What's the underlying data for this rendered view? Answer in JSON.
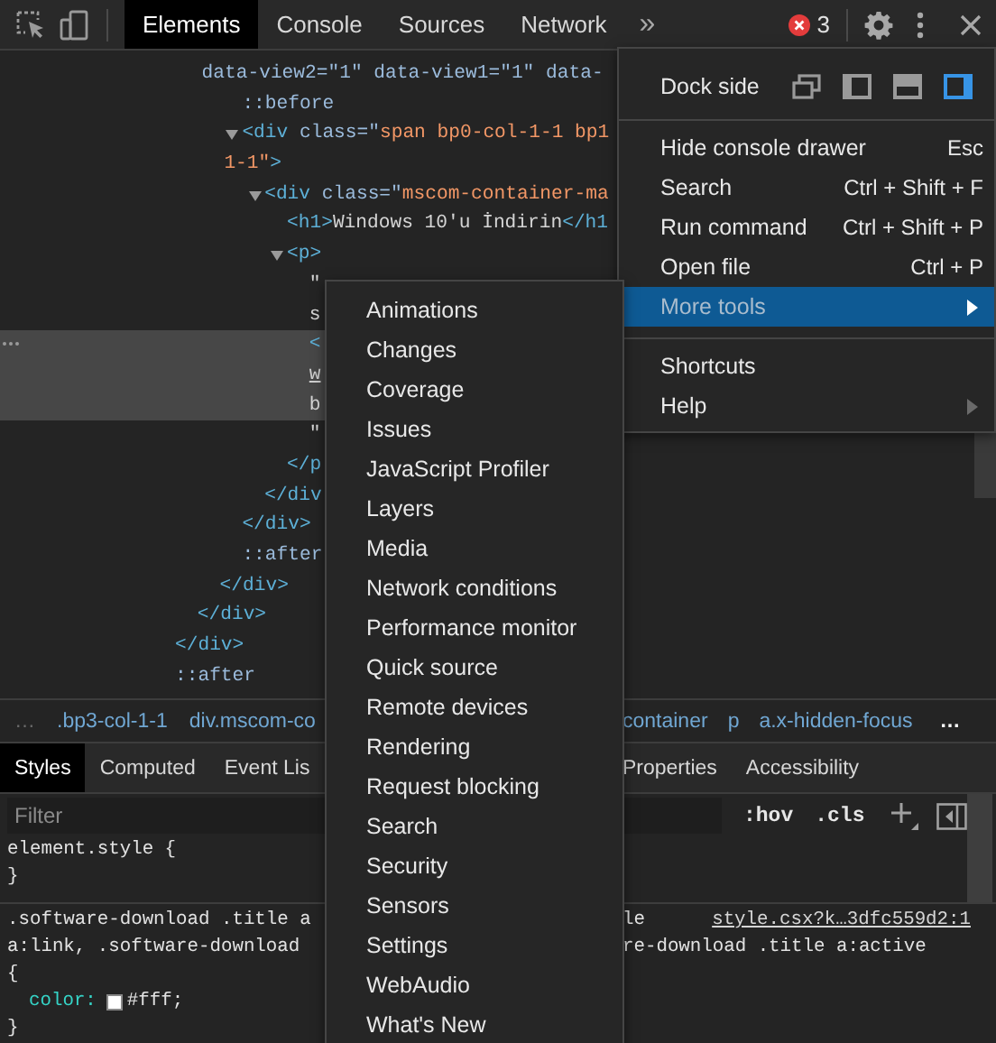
{
  "toolbar": {
    "tabs": [
      {
        "label": "Elements",
        "selected": true
      },
      {
        "label": "Console",
        "selected": false
      },
      {
        "label": "Sources",
        "selected": false
      },
      {
        "label": "Network",
        "selected": false
      }
    ],
    "more_tabs": "»",
    "error_count": "3"
  },
  "tree": [
    {
      "selected": false,
      "children": [
        {
          "selected": false,
          "children": [
            {
              "selected": false,
              "lines": [
                {
                  "wrapped": true,
                  "tokens": [
                    {
                      "kind": "attr",
                      "text": "data-view2=\"1\" data-view1=\"1\" data-"
                    }
                  ]
                }
              ],
              "children": [
                {
                  "selected": false,
                  "lines": [
                    {
                      "tokens": [
                        {
                          "kind": "pseudo",
                          "text": "::before"
                        }
                      ]
                    }
                  ]
                },
                {
                  "selected": false,
                  "expanded": true,
                  "lines": [
                    {
                      "tokens": [
                        {
                          "kind": "tag",
                          "text": "<div"
                        },
                        {
                          "kind": "attr",
                          "text": " class=\""
                        },
                        {
                          "kind": "value",
                          "text": "span bp0-col-1-1 bp1"
                        }
                      ]
                    },
                    {
                      "wrapped": true,
                      "tokens": [
                        {
                          "kind": "value",
                          "text": "1-1\""
                        },
                        {
                          "kind": "tag",
                          "text": ">"
                        }
                      ]
                    }
                  ],
                  "children": [
                    {
                      "selected": false,
                      "expanded": true,
                      "lines": [
                        {
                          "tokens": [
                            {
                              "kind": "tag",
                              "text": "<div"
                            },
                            {
                              "kind": "attr",
                              "text": " class=\""
                            },
                            {
                              "kind": "value",
                              "text": "mscom-container-ma"
                            }
                          ]
                        }
                      ],
                      "children": [
                        {
                          "selected": false,
                          "lines": [
                            {
                              "tokens": [
                                {
                                  "kind": "tag",
                                  "text": "<h1>"
                                },
                                {
                                  "kind": "text",
                                  "text": "Windows 10'u İndirin"
                                },
                                {
                                  "kind": "tag",
                                  "text": "</h1"
                                }
                              ]
                            }
                          ]
                        },
                        {
                          "selected": false,
                          "expanded": true,
                          "lines": [
                            {
                              "tokens": [
                                {
                                  "kind": "tag",
                                  "text": "<p>"
                                }
                              ]
                            }
                          ],
                          "children": [
                            {
                              "selected": false,
                              "lines": [
                                {
                                  "tokens": [
                                    {
                                      "kind": "text",
                                      "text": "\""
                                    }
                                  ]
                                },
                                {
                                  "tokens": [
                                    {
                                      "kind": "text",
                                      "text": "s"
                                    }
                                  ]
                                }
                              ]
                            },
                            {
                              "selected": true,
                              "lines": [
                                {
                                  "tokens": [
                                    {
                                      "kind": "tag",
                                      "text": "<"
                                    }
                                  ]
                                },
                                {
                                  "tokens": [
                                    {
                                      "kind": "link",
                                      "text": "w"
                                    }
                                  ]
                                },
                                {
                                  "tokens": [
                                    {
                                      "kind": "text",
                                      "text": "b"
                                    }
                                  ]
                                }
                              ]
                            },
                            {
                              "selected": false,
                              "lines": [
                                {
                                  "tokens": [
                                    {
                                      "kind": "text",
                                      "text": "\""
                                    }
                                  ]
                                }
                              ]
                            }
                          ],
                          "close": [
                            {
                              "kind": "tag",
                              "text": "</p"
                            }
                          ]
                        }
                      ],
                      "close": [
                        {
                          "kind": "tag",
                          "text": "</div"
                        }
                      ]
                    }
                  ],
                  "close": [
                    {
                      "kind": "tag",
                      "text": "</div>"
                    }
                  ]
                },
                {
                  "selected": false,
                  "lines": [
                    {
                      "tokens": [
                        {
                          "kind": "pseudo",
                          "text": "::after"
                        }
                      ]
                    }
                  ]
                }
              ],
              "close": [
                {
                  "kind": "tag",
                  "text": "</div>"
                }
              ]
            }
          ],
          "close": [
            {
              "kind": "tag",
              "text": "</div>"
            }
          ]
        }
      ],
      "close": [
        {
          "kind": "tag",
          "text": "</div>"
        }
      ]
    },
    {
      "selected": false,
      "lines": [
        {
          "tokens": [
            {
              "kind": "pseudo",
              "text": "::after"
            }
          ]
        }
      ]
    }
  ],
  "breadcrumbs": {
    "left": [
      {
        "text": "…",
        "kind": "more"
      },
      {
        "text": ".bp3-col-1-1",
        "kind": "crumb"
      },
      {
        "text": "div.mscom-co",
        "kind": "crumb"
      }
    ],
    "right": [
      {
        "text": "container",
        "kind": "crumb"
      },
      {
        "text": "p",
        "kind": "crumb"
      },
      {
        "text": "a.x-hidden-focus",
        "kind": "crumb"
      },
      {
        "text": "…",
        "kind": "more"
      }
    ]
  },
  "sidebar_tabs": {
    "left": [
      {
        "label": "Styles",
        "selected": true
      },
      {
        "label": "Computed",
        "selected": false
      },
      {
        "label": "Event Lis",
        "selected": false
      }
    ],
    "right": [
      {
        "label": "Properties",
        "selected": false
      },
      {
        "label": "Accessibility",
        "selected": false
      }
    ]
  },
  "filter": {
    "placeholder": "Filter",
    "buttons": [
      ":hov",
      ".cls"
    ]
  },
  "rules": [
    {
      "selector_lines": [
        {
          "left": "element.style {"
        }
      ],
      "close": "}"
    },
    {
      "selector_lines": [
        {
          "left": ".software-download .title a",
          "right": "le",
          "source": "style.csx?k…3dfc559d2:1"
        },
        {
          "left": "a:link, .software-download",
          "right": "re-download .title a:active"
        }
      ],
      "open": "{",
      "declarations": [
        {
          "property": "color:",
          "value": "#fff;"
        }
      ],
      "close": "}"
    }
  ],
  "main_menu": {
    "dock_side": {
      "label": "Dock side",
      "options": [
        {
          "kind": "undock",
          "selected": false
        },
        {
          "kind": "left",
          "selected": false
        },
        {
          "kind": "bottom",
          "selected": false
        },
        {
          "kind": "right",
          "selected": true
        }
      ]
    },
    "groups": [
      [
        {
          "label": "Hide console drawer",
          "shortcut": "Esc",
          "submenu": false,
          "selected": false
        },
        {
          "label": "Search",
          "shortcut": "Ctrl + Shift + F",
          "submenu": false,
          "selected": false
        },
        {
          "label": "Run command",
          "shortcut": "Ctrl + Shift + P",
          "submenu": false,
          "selected": false
        },
        {
          "label": "Open file",
          "shortcut": "Ctrl + P",
          "submenu": false,
          "selected": false
        },
        {
          "label": "More tools",
          "submenu": true,
          "selected": true
        }
      ],
      [
        {
          "label": "Shortcuts",
          "submenu": false,
          "selected": false
        },
        {
          "label": "Help",
          "submenu": true,
          "selected": false
        }
      ]
    ]
  },
  "more_tools_menu": [
    "Animations",
    "Changes",
    "Coverage",
    "Issues",
    "JavaScript Profiler",
    "Layers",
    "Media",
    "Network conditions",
    "Performance monitor",
    "Quick source",
    "Remote devices",
    "Rendering",
    "Request blocking",
    "Search",
    "Security",
    "Sensors",
    "Settings",
    "WebAudio",
    "What's New"
  ]
}
